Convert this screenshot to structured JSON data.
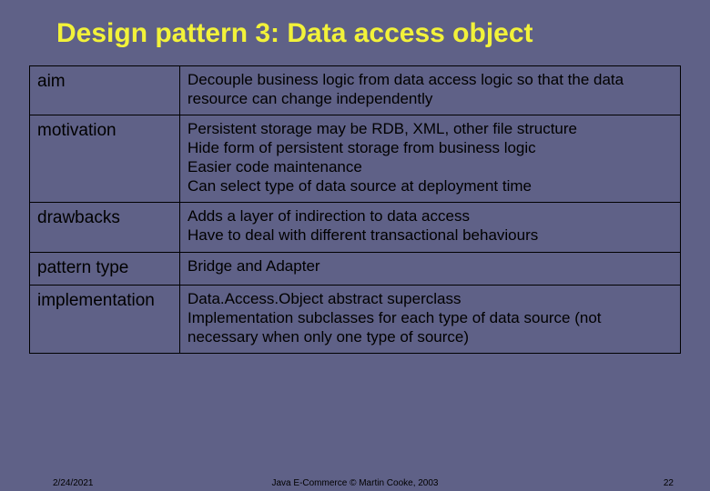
{
  "title": "Design pattern 3: Data access object",
  "rows": [
    {
      "label": "aim",
      "lines": [
        "Decouple business logic from data access logic so that the data resource can change independently"
      ]
    },
    {
      "label": "motivation",
      "lines": [
        "Persistent storage may be RDB, XML, other file structure",
        "Hide form of persistent storage from business logic",
        "Easier code maintenance",
        "Can select type of data source at deployment time"
      ]
    },
    {
      "label": "drawbacks",
      "lines": [
        "Adds a layer of indirection to data access",
        "Have to deal with different transactional behaviours"
      ]
    },
    {
      "label": "pattern type",
      "lines": [
        "Bridge and Adapter"
      ]
    },
    {
      "label": "implementation",
      "lines": [
        "Data.Access.Object abstract superclass",
        "Implementation subclasses for each type of data source (not necessary when only one type of source)"
      ]
    }
  ],
  "footer": {
    "date": "2/24/2021",
    "center": "Java E-Commerce © Martin Cooke, 2003",
    "page": "22"
  }
}
